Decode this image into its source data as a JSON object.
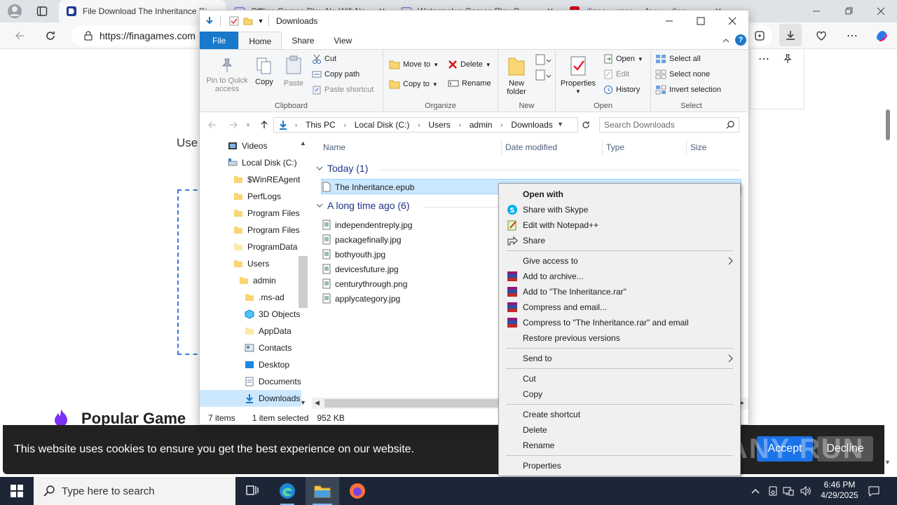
{
  "browser": {
    "tabs": [
      {
        "label": "File Download The Inheritance Di"
      },
      {
        "label": "Offline Games Play No Wifi No"
      },
      {
        "label": "Watermelon Games Play O..."
      },
      {
        "label": "diane ...ence.  ...fa.v. ...ding..."
      }
    ],
    "url": "https://finagames.com"
  },
  "page": {
    "use_text": "Use",
    "popular_heading": "Popular Game",
    "cookie_text": "This website uses cookies to ensure you get the best experience on our website.",
    "accept_label": "Accept",
    "decline_label": "Decline",
    "watermark": "ANY RUN"
  },
  "explorer": {
    "title": "Downloads",
    "ribbon_tabs": [
      "File",
      "Home",
      "Share",
      "View"
    ],
    "clipboard": {
      "pin_label": "Pin to Quick access",
      "copy_label": "Copy",
      "paste_label": "Paste",
      "cut_label": "Cut",
      "copy_path_label": "Copy path",
      "paste_shortcut_label": "Paste shortcut",
      "group_label": "Clipboard"
    },
    "organize": {
      "move_to_label": "Move to",
      "copy_to_label": "Copy to",
      "delete_label": "Delete",
      "rename_label": "Rename",
      "group_label": "Organize"
    },
    "new": {
      "new_folder_label": "New folder",
      "group_label": "New"
    },
    "open": {
      "properties_label": "Properties",
      "open_label": "Open",
      "edit_label": "Edit",
      "history_label": "History",
      "group_label": "Open"
    },
    "select": {
      "select_all_label": "Select all",
      "select_none_label": "Select none",
      "invert_label": "Invert selection",
      "group_label": "Select"
    },
    "breadcrumb": [
      "This PC",
      "Local Disk (C:)",
      "Users",
      "admin",
      "Downloads"
    ],
    "search_placeholder": "Search Downloads",
    "nav_items": [
      {
        "label": "Videos"
      },
      {
        "label": "Local Disk (C:)"
      },
      {
        "label": "$WinREAgent"
      },
      {
        "label": "PerfLogs"
      },
      {
        "label": "Program Files"
      },
      {
        "label": "Program Files"
      },
      {
        "label": "ProgramData"
      },
      {
        "label": "Users"
      },
      {
        "label": "admin"
      },
      {
        "label": ".ms-ad"
      },
      {
        "label": "3D Objects"
      },
      {
        "label": "AppData"
      },
      {
        "label": "Contacts"
      },
      {
        "label": "Desktop"
      },
      {
        "label": "Documents"
      },
      {
        "label": "Downloads"
      }
    ],
    "columns": {
      "name": "Name",
      "date": "Date modified",
      "type": "Type",
      "size": "Size"
    },
    "groups": [
      {
        "label": "Today (1)",
        "files": [
          "The Inheritance.epub"
        ]
      },
      {
        "label": "A long time ago (6)",
        "files": [
          "independentreply.jpg",
          "packagefinally.jpg",
          "bothyouth.jpg",
          "devicesfuture.jpg",
          "centurythrough.png",
          "applycategory.jpg"
        ]
      }
    ],
    "status": {
      "items": "7 items",
      "selected": "1 item selected",
      "size": "952 KB"
    }
  },
  "context_menu": {
    "items": [
      {
        "label": "Open with"
      },
      {
        "label": "Share with Skype"
      },
      {
        "label": "Edit with Notepad++"
      },
      {
        "label": "Share"
      },
      {
        "label": "Give access to"
      },
      {
        "label": "Add to archive..."
      },
      {
        "label": "Add to \"The Inheritance.rar\""
      },
      {
        "label": "Compress and email..."
      },
      {
        "label": "Compress to \"The Inheritance.rar\" and email"
      },
      {
        "label": "Restore previous versions"
      },
      {
        "label": "Send to"
      },
      {
        "label": "Cut"
      },
      {
        "label": "Copy"
      },
      {
        "label": "Create shortcut"
      },
      {
        "label": "Delete"
      },
      {
        "label": "Rename"
      },
      {
        "label": "Properties"
      }
    ]
  },
  "taskbar": {
    "search_placeholder": "Type here to search",
    "time": "6:46 PM",
    "date": "4/29/2025"
  },
  "colors": {
    "accent": "#1979ca",
    "taskbar": "#1c2636",
    "selection": "#cce8ff"
  }
}
